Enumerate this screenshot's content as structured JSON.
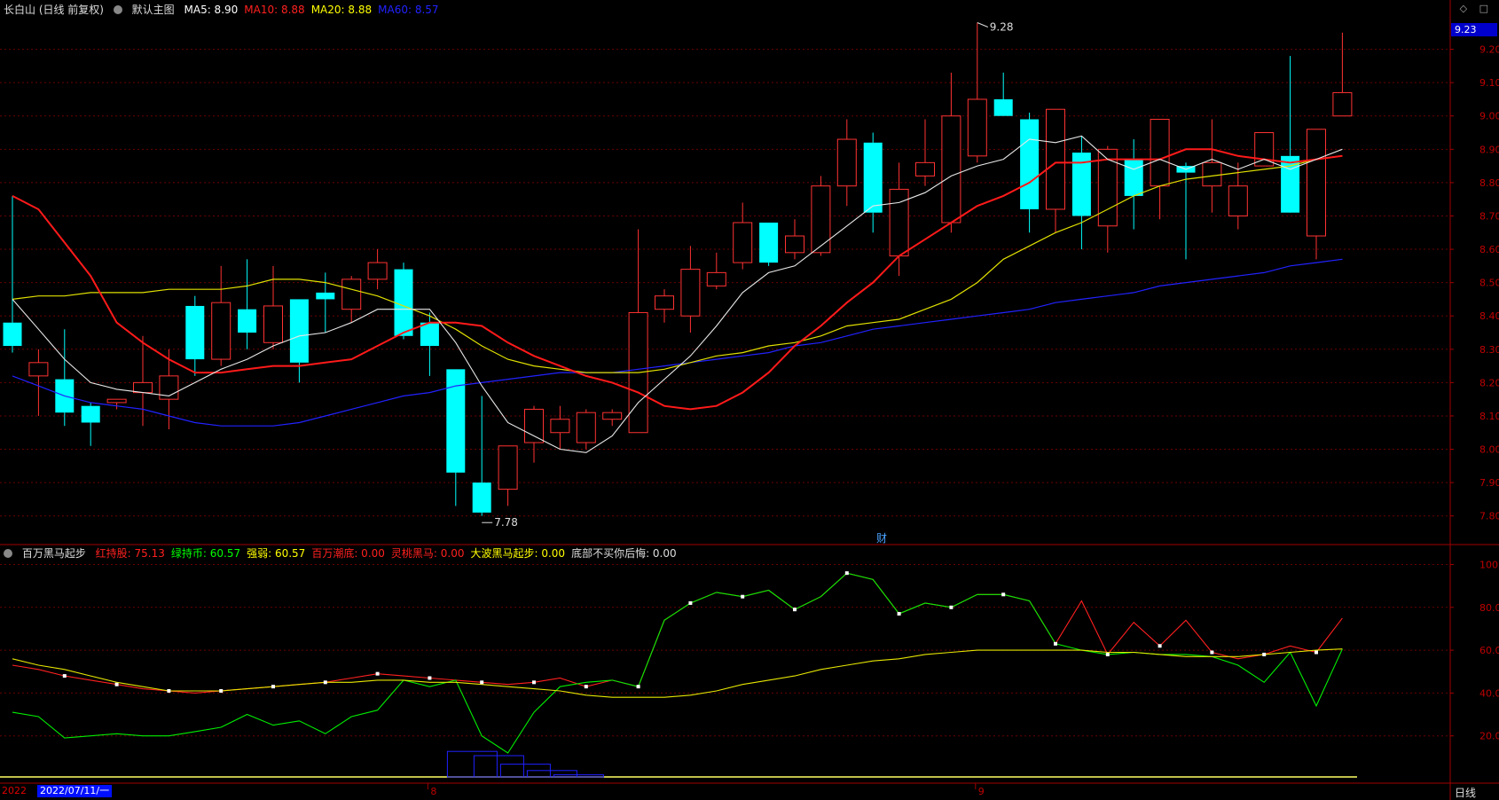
{
  "header": {
    "title": "长白山 (日线 前复权)",
    "main_menu": "默认主图",
    "ma": [
      {
        "label": "MA5: 8.90",
        "color": "#ffffff"
      },
      {
        "label": "MA10: 8.88",
        "color": "#ff2020"
      },
      {
        "label": "MA20: 8.88",
        "color": "#ffff00"
      },
      {
        "label": "MA60: 8.57",
        "color": "#2222ff"
      }
    ]
  },
  "indicator": {
    "name": "百万黑马起步",
    "items": [
      {
        "label": "红持股: 75.13",
        "color": "#ff2020"
      },
      {
        "label": "绿持币: 60.57",
        "color": "#00ff00"
      },
      {
        "label": "强弱: 60.57",
        "color": "#ffff00"
      },
      {
        "label": "百万潮底: 0.00",
        "color": "#ff2020"
      },
      {
        "label": "灵桃黑马: 0.00",
        "color": "#ff2020"
      },
      {
        "label": "大波黑马起步: 0.00",
        "color": "#ffff00"
      },
      {
        "label": "底部不买你后悔: 0.00",
        "color": "#dddddd"
      }
    ]
  },
  "top_icons": [
    "◇",
    "□"
  ],
  "price_badge": "9.23",
  "cai_label": "财",
  "footer": {
    "year": "2022",
    "date": "2022/07/11/一",
    "period": "日线",
    "month_marks": [
      "8",
      "9"
    ]
  },
  "chart_data": [
    {
      "type": "candlestick",
      "ylim": [
        7.73,
        9.3
      ],
      "y_ticks": [
        "9.20",
        "9.10",
        "9.00",
        "8.90",
        "8.80",
        "8.70",
        "8.60",
        "8.50",
        "8.40",
        "8.30",
        "8.20",
        "8.10",
        "8.00",
        "7.90",
        "7.80"
      ],
      "candles": [
        [
          8.38,
          8.76,
          8.29,
          8.31
        ],
        [
          8.22,
          8.3,
          8.1,
          8.26
        ],
        [
          8.21,
          8.36,
          8.07,
          8.11
        ],
        [
          8.13,
          8.14,
          8.01,
          8.08
        ],
        [
          8.14,
          8.15,
          8.12,
          8.15
        ],
        [
          8.17,
          8.34,
          8.07,
          8.2
        ],
        [
          8.15,
          8.3,
          8.06,
          8.22
        ],
        [
          8.43,
          8.46,
          8.22,
          8.27
        ],
        [
          8.27,
          8.55,
          8.25,
          8.44
        ],
        [
          8.42,
          8.57,
          8.3,
          8.35
        ],
        [
          8.32,
          8.55,
          8.3,
          8.43
        ],
        [
          8.45,
          8.45,
          8.2,
          8.26
        ],
        [
          8.47,
          8.53,
          8.35,
          8.45
        ],
        [
          8.42,
          8.52,
          8.38,
          8.51
        ],
        [
          8.51,
          8.6,
          8.48,
          8.56
        ],
        [
          8.54,
          8.56,
          8.33,
          8.34
        ],
        [
          8.38,
          8.41,
          8.22,
          8.31
        ],
        [
          8.24,
          8.24,
          7.83,
          7.93
        ],
        [
          7.9,
          8.16,
          7.8,
          7.81
        ],
        [
          7.88,
          8.01,
          7.83,
          8.01
        ],
        [
          8.02,
          8.13,
          7.96,
          8.12
        ],
        [
          8.05,
          8.13,
          8.0,
          8.09
        ],
        [
          8.02,
          8.12,
          8.0,
          8.11
        ],
        [
          8.09,
          8.12,
          8.07,
          8.11
        ],
        [
          8.05,
          8.66,
          8.05,
          8.41
        ],
        [
          8.42,
          8.48,
          8.38,
          8.46
        ],
        [
          8.4,
          8.61,
          8.35,
          8.54
        ],
        [
          8.49,
          8.59,
          8.48,
          8.53
        ],
        [
          8.56,
          8.74,
          8.54,
          8.68
        ],
        [
          8.68,
          8.68,
          8.55,
          8.56
        ],
        [
          8.59,
          8.69,
          8.57,
          8.64
        ],
        [
          8.59,
          8.82,
          8.58,
          8.79
        ],
        [
          8.79,
          8.99,
          8.73,
          8.93
        ],
        [
          8.92,
          8.95,
          8.65,
          8.71
        ],
        [
          8.58,
          8.86,
          8.52,
          8.78
        ],
        [
          8.82,
          8.99,
          8.79,
          8.86
        ],
        [
          8.68,
          9.13,
          8.65,
          9.0
        ],
        [
          8.88,
          9.28,
          8.86,
          9.05
        ],
        [
          9.05,
          9.13,
          9.0,
          9.0
        ],
        [
          8.99,
          9.01,
          8.65,
          8.72
        ],
        [
          8.72,
          9.02,
          8.65,
          9.02
        ],
        [
          8.89,
          8.94,
          8.6,
          8.7
        ],
        [
          8.67,
          8.91,
          8.59,
          8.9
        ],
        [
          8.87,
          8.93,
          8.66,
          8.76
        ],
        [
          8.79,
          8.99,
          8.69,
          8.99
        ],
        [
          8.85,
          8.86,
          8.57,
          8.83
        ],
        [
          8.79,
          8.99,
          8.71,
          8.86
        ],
        [
          8.7,
          8.86,
          8.66,
          8.79
        ],
        [
          8.85,
          8.95,
          8.85,
          8.95
        ],
        [
          8.88,
          9.18,
          8.72,
          8.71
        ],
        [
          8.64,
          8.96,
          8.57,
          8.96
        ],
        [
          9.0,
          9.25,
          9.0,
          9.07
        ]
      ],
      "ma5": [
        8.45,
        8.36,
        8.27,
        8.2,
        8.18,
        8.17,
        8.16,
        8.2,
        8.24,
        8.27,
        8.31,
        8.34,
        8.35,
        8.38,
        8.42,
        8.42,
        8.42,
        8.32,
        8.19,
        8.08,
        8.04,
        8.0,
        7.99,
        8.04,
        8.14,
        8.21,
        8.28,
        8.37,
        8.47,
        8.53,
        8.55,
        8.61,
        8.67,
        8.73,
        8.74,
        8.77,
        8.82,
        8.85,
        8.87,
        8.93,
        8.92,
        8.94,
        8.87,
        8.84,
        8.87,
        8.84,
        8.87,
        8.84,
        8.87,
        8.84,
        8.87,
        8.9
      ],
      "ma10": [
        8.76,
        8.72,
        8.62,
        8.52,
        8.38,
        8.32,
        8.27,
        8.23,
        8.23,
        8.24,
        8.25,
        8.25,
        8.26,
        8.27,
        8.31,
        8.35,
        8.38,
        8.38,
        8.37,
        8.32,
        8.28,
        8.25,
        8.22,
        8.2,
        8.17,
        8.13,
        8.12,
        8.13,
        8.17,
        8.23,
        8.31,
        8.37,
        8.44,
        8.5,
        8.58,
        8.63,
        8.68,
        8.73,
        8.76,
        8.8,
        8.86,
        8.86,
        8.87,
        8.87,
        8.87,
        8.9,
        8.9,
        8.88,
        8.87,
        8.86,
        8.87,
        8.88
      ],
      "ma20": [
        8.45,
        8.46,
        8.46,
        8.47,
        8.47,
        8.47,
        8.48,
        8.48,
        8.48,
        8.49,
        8.51,
        8.51,
        8.5,
        8.48,
        8.46,
        8.43,
        8.4,
        8.36,
        8.31,
        8.27,
        8.25,
        8.24,
        8.23,
        8.23,
        8.23,
        8.24,
        8.26,
        8.28,
        8.29,
        8.31,
        8.32,
        8.34,
        8.37,
        8.38,
        8.39,
        8.42,
        8.45,
        8.5,
        8.57,
        8.61,
        8.65,
        8.68,
        8.72,
        8.76,
        8.79,
        8.81,
        8.82,
        8.83,
        8.84,
        8.85,
        8.87,
        8.88
      ],
      "ma60": [
        8.22,
        8.19,
        8.16,
        8.14,
        8.13,
        8.12,
        8.1,
        8.08,
        8.07,
        8.07,
        8.07,
        8.08,
        8.1,
        8.12,
        8.14,
        8.16,
        8.17,
        8.19,
        8.2,
        8.21,
        8.22,
        8.23,
        8.23,
        8.23,
        8.24,
        8.25,
        8.26,
        8.27,
        8.28,
        8.29,
        8.31,
        8.32,
        8.34,
        8.36,
        8.37,
        8.38,
        8.39,
        8.4,
        8.41,
        8.42,
        8.44,
        8.45,
        8.46,
        8.47,
        8.49,
        8.5,
        8.51,
        8.52,
        8.53,
        8.55,
        8.56,
        8.57
      ],
      "annotations": [
        {
          "index": 37,
          "value": 9.28,
          "label": "9.28"
        },
        {
          "index": 18,
          "value": 7.78,
          "label": "7.78"
        }
      ]
    },
    {
      "type": "line",
      "title": "百万黑马起步",
      "ylim": [
        0,
        106
      ],
      "y_ticks": [
        "100.00",
        "80.00",
        "60.00",
        "40.00",
        "20.00"
      ],
      "series": [
        {
          "name": "红持股",
          "color": "#ff2020",
          "values": [
            53,
            51,
            48,
            46,
            44,
            42,
            41,
            40,
            41,
            42,
            43,
            44,
            45,
            47,
            49,
            48,
            47,
            46,
            45,
            44,
            45,
            47,
            43,
            46,
            43,
            74,
            82,
            87,
            85,
            88,
            79,
            85,
            96,
            93,
            77,
            82,
            80,
            86,
            86,
            83,
            63,
            83,
            58,
            73,
            62,
            74,
            59,
            56,
            58,
            62,
            59,
            75
          ]
        },
        {
          "name": "绿持币",
          "color": "#00ff00",
          "values": [
            31,
            29,
            19,
            20,
            21,
            20,
            20,
            22,
            24,
            30,
            25,
            27,
            21,
            29,
            32,
            46,
            43,
            46,
            20,
            12,
            31,
            43,
            45,
            46,
            43,
            74,
            82,
            87,
            85,
            88,
            79,
            85,
            96,
            93,
            77,
            82,
            80,
            86,
            86,
            83,
            63,
            60,
            58,
            59,
            58,
            58,
            57,
            53,
            45,
            59,
            34,
            60.57
          ]
        },
        {
          "name": "强弱",
          "color": "#ffff00",
          "values": [
            56,
            53,
            51,
            48,
            45,
            43,
            41,
            41,
            41,
            42,
            43,
            44,
            45,
            45,
            46,
            46,
            45,
            45,
            44,
            43,
            42,
            41,
            39,
            38,
            38,
            38,
            39,
            41,
            44,
            46,
            48,
            51,
            53,
            55,
            56,
            58,
            59,
            60,
            60,
            60,
            60,
            60,
            59,
            59,
            58,
            57,
            57,
            57,
            58,
            59,
            60,
            60.57
          ]
        }
      ],
      "markers": [
        2,
        4,
        6,
        8,
        10,
        12,
        14,
        16,
        18,
        20,
        22,
        24,
        26,
        28,
        30,
        32,
        34,
        36,
        38,
        40,
        42,
        44,
        46,
        48,
        50
      ],
      "volume_steps": [
        12,
        10,
        6,
        3,
        1
      ]
    }
  ]
}
